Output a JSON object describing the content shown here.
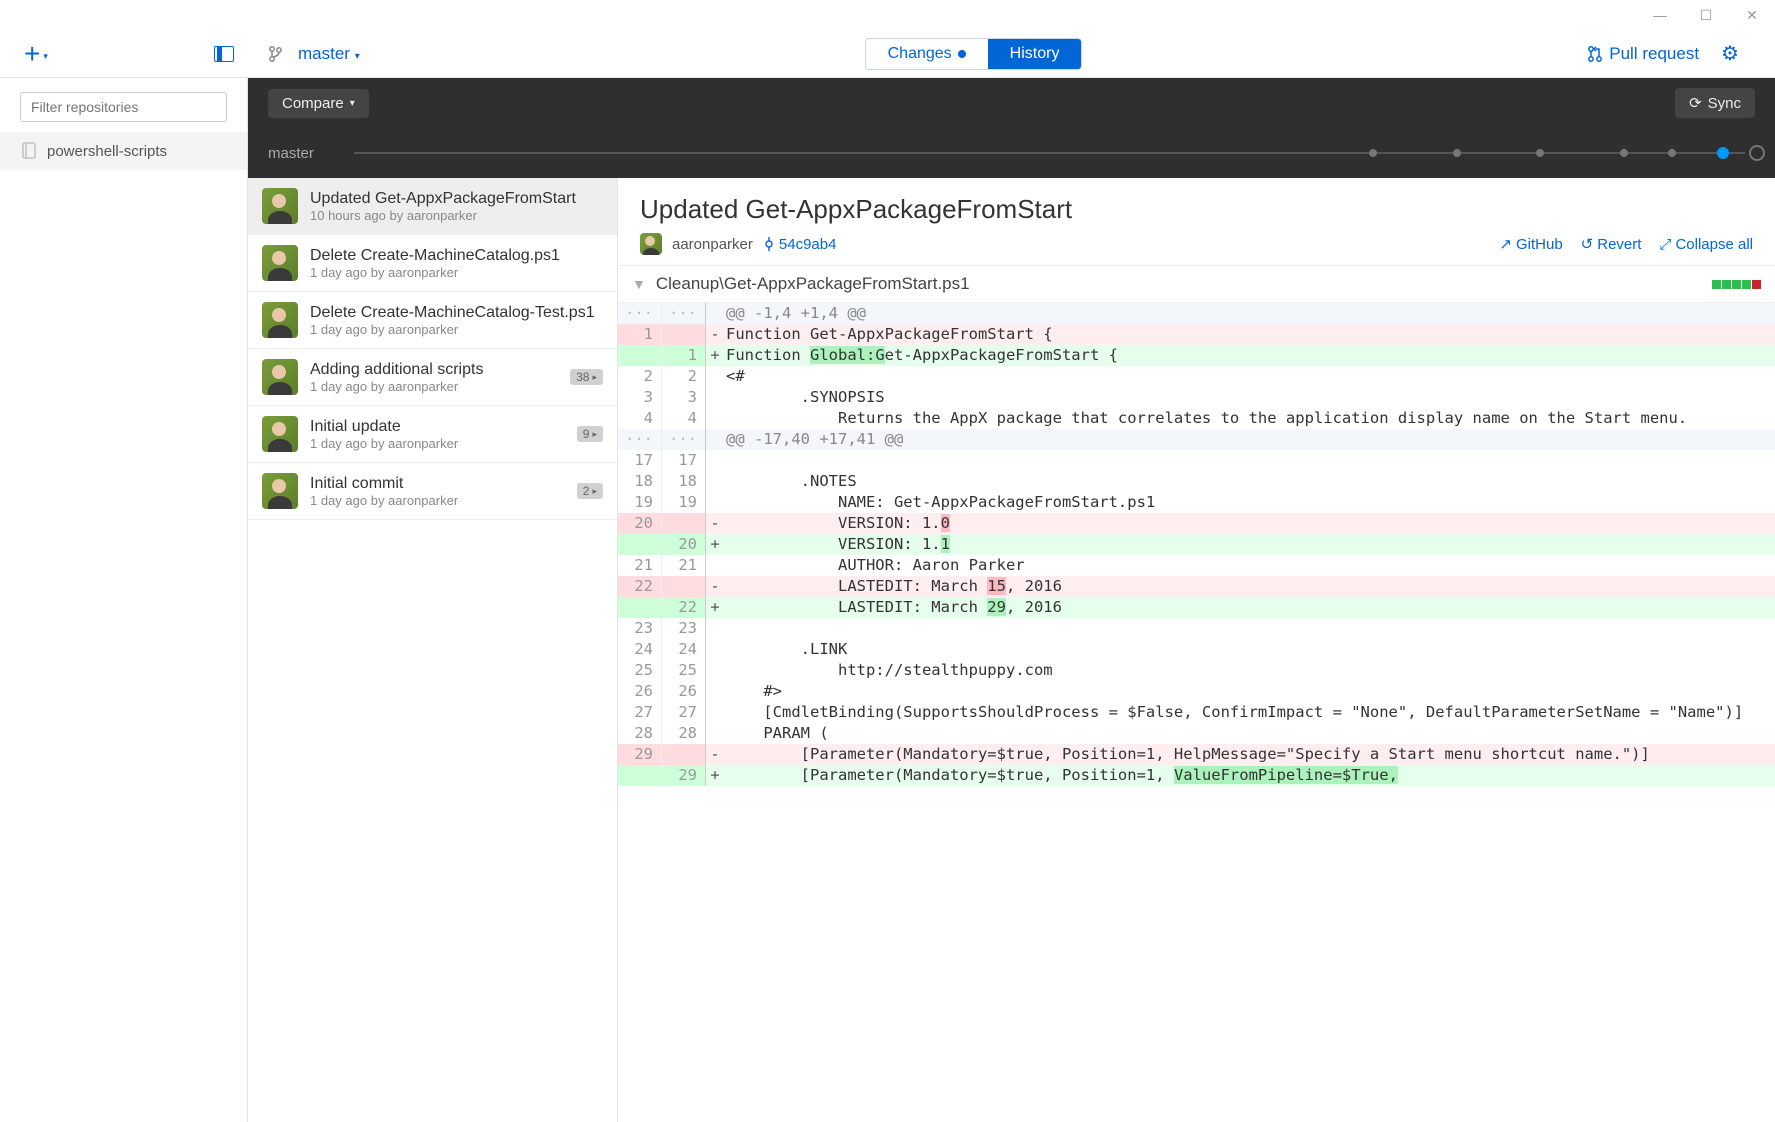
{
  "window": {
    "minimize": "—",
    "maximize": "☐",
    "close": "✕"
  },
  "toolbar": {
    "branch": "master",
    "tabs": {
      "changes": "Changes",
      "history": "History"
    },
    "pull_request": "Pull request"
  },
  "sidebar": {
    "filter_placeholder": "Filter repositories",
    "repos": [
      {
        "name": "powershell-scripts"
      }
    ]
  },
  "compare": {
    "label": "Compare",
    "sync": "Sync"
  },
  "timeline": {
    "branch_label": "master"
  },
  "commits": [
    {
      "title": "Updated Get-AppxPackageFromStart",
      "meta": "10 hours ago by aaronparker",
      "selected": true
    },
    {
      "title": "Delete Create-MachineCatalog.ps1",
      "meta": "1 day ago by aaronparker"
    },
    {
      "title": "Delete Create-MachineCatalog-Test.ps1",
      "meta": "1 day ago by aaronparker"
    },
    {
      "title": "Adding additional scripts",
      "meta": "1 day ago by aaronparker",
      "badge": "38"
    },
    {
      "title": "Initial update",
      "meta": "1 day ago by aaronparker",
      "badge": "9"
    },
    {
      "title": "Initial commit",
      "meta": "1 day ago by aaronparker",
      "badge": "2"
    }
  ],
  "detail": {
    "title": "Updated Get-AppxPackageFromStart",
    "author": "aaronparker",
    "sha": "54c9ab4",
    "actions": {
      "github": "GitHub",
      "revert": "Revert",
      "collapse": "Collapse all"
    },
    "file_path": "Cleanup\\Get-AppxPackageFromStart.ps1"
  },
  "diff": [
    {
      "t": "hunk",
      "a": "···",
      "b": "···",
      "m": "",
      "c": "@@ -1,4 +1,4 @@"
    },
    {
      "t": "del",
      "a": "1",
      "b": "",
      "m": "-",
      "c": "Function Get-AppxPackageFromStart {"
    },
    {
      "t": "add",
      "a": "",
      "b": "1",
      "m": "+",
      "pre": "Function ",
      "hl": "Global:G",
      "post": "et-AppxPackageFromStart {"
    },
    {
      "t": "ctx",
      "a": "2",
      "b": "2",
      "m": "",
      "c": "<#"
    },
    {
      "t": "ctx",
      "a": "3",
      "b": "3",
      "m": "",
      "c": "        .SYNOPSIS"
    },
    {
      "t": "ctx",
      "a": "4",
      "b": "4",
      "m": "",
      "c": "            Returns the AppX package that correlates to the application display name on the Start menu."
    },
    {
      "t": "hunk",
      "a": "···",
      "b": "···",
      "m": "",
      "c": "@@ -17,40 +17,41 @@"
    },
    {
      "t": "ctx",
      "a": "17",
      "b": "17",
      "m": "",
      "c": ""
    },
    {
      "t": "ctx",
      "a": "18",
      "b": "18",
      "m": "",
      "c": "        .NOTES"
    },
    {
      "t": "ctx",
      "a": "19",
      "b": "19",
      "m": "",
      "c": "            NAME: Get-AppxPackageFromStart.ps1"
    },
    {
      "t": "del",
      "a": "20",
      "b": "",
      "m": "-",
      "pre": "            VERSION: 1.",
      "hl": "0",
      "post": ""
    },
    {
      "t": "add",
      "a": "",
      "b": "20",
      "m": "+",
      "pre": "            VERSION: 1.",
      "hl": "1",
      "post": ""
    },
    {
      "t": "ctx",
      "a": "21",
      "b": "21",
      "m": "",
      "c": "            AUTHOR: Aaron Parker"
    },
    {
      "t": "del",
      "a": "22",
      "b": "",
      "m": "-",
      "pre": "            LASTEDIT: March ",
      "hl": "15",
      "post": ", 2016"
    },
    {
      "t": "add",
      "a": "",
      "b": "22",
      "m": "+",
      "pre": "            LASTEDIT: March ",
      "hl": "29",
      "post": ", 2016"
    },
    {
      "t": "ctx",
      "a": "23",
      "b": "23",
      "m": "",
      "c": ""
    },
    {
      "t": "ctx",
      "a": "24",
      "b": "24",
      "m": "",
      "c": "        .LINK"
    },
    {
      "t": "ctx",
      "a": "25",
      "b": "25",
      "m": "",
      "c": "            http://stealthpuppy.com"
    },
    {
      "t": "ctx",
      "a": "26",
      "b": "26",
      "m": "",
      "c": "    #>"
    },
    {
      "t": "ctx",
      "a": "27",
      "b": "27",
      "m": "",
      "c": "    [CmdletBinding(SupportsShouldProcess = $False, ConfirmImpact = \"None\", DefaultParameterSetName = \"Name\")]"
    },
    {
      "t": "ctx",
      "a": "28",
      "b": "28",
      "m": "",
      "c": "    PARAM ("
    },
    {
      "t": "del",
      "a": "29",
      "b": "",
      "m": "-",
      "c": "        [Parameter(Mandatory=$true, Position=1, HelpMessage=\"Specify a Start menu shortcut name.\")]"
    },
    {
      "t": "add",
      "a": "",
      "b": "29",
      "m": "+",
      "pre": "        [Parameter(Mandatory=$true, Position=1, ",
      "hl": "ValueFromPipeline=$True,",
      "post": ""
    }
  ]
}
